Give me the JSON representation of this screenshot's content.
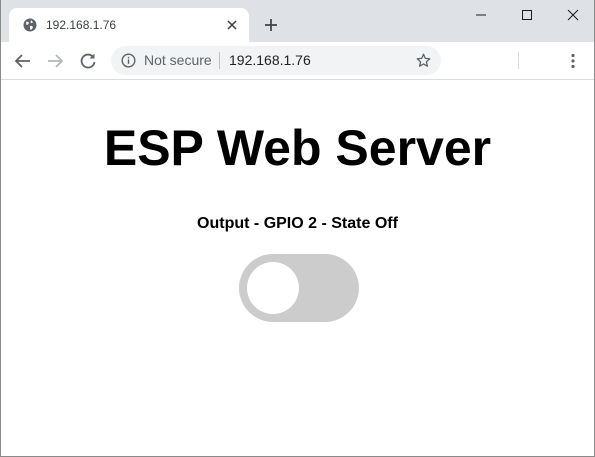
{
  "browser": {
    "tab": {
      "title": "192.168.1.76",
      "favicon": "globe-icon",
      "close_icon": "close-icon"
    },
    "new_tab_icon": "plus-icon",
    "window_controls": [
      "minimize-icon",
      "maximize-icon",
      "close-icon"
    ],
    "toolbar": {
      "back_icon": "arrow-left-icon",
      "forward_icon": "arrow-right-icon",
      "reload_icon": "reload-icon",
      "menu_icon": "kebab-menu-icon"
    },
    "omnibox": {
      "security_icon": "info-icon",
      "security_label": "Not secure",
      "url": "192.168.1.76",
      "bookmark_icon": "star-icon"
    }
  },
  "page": {
    "heading": "ESP Web Server",
    "output_label": "Output - GPIO 2 - State Off",
    "toggle": {
      "checked": false,
      "off_color": "#cccccc",
      "knob_color": "#ffffff"
    }
  }
}
